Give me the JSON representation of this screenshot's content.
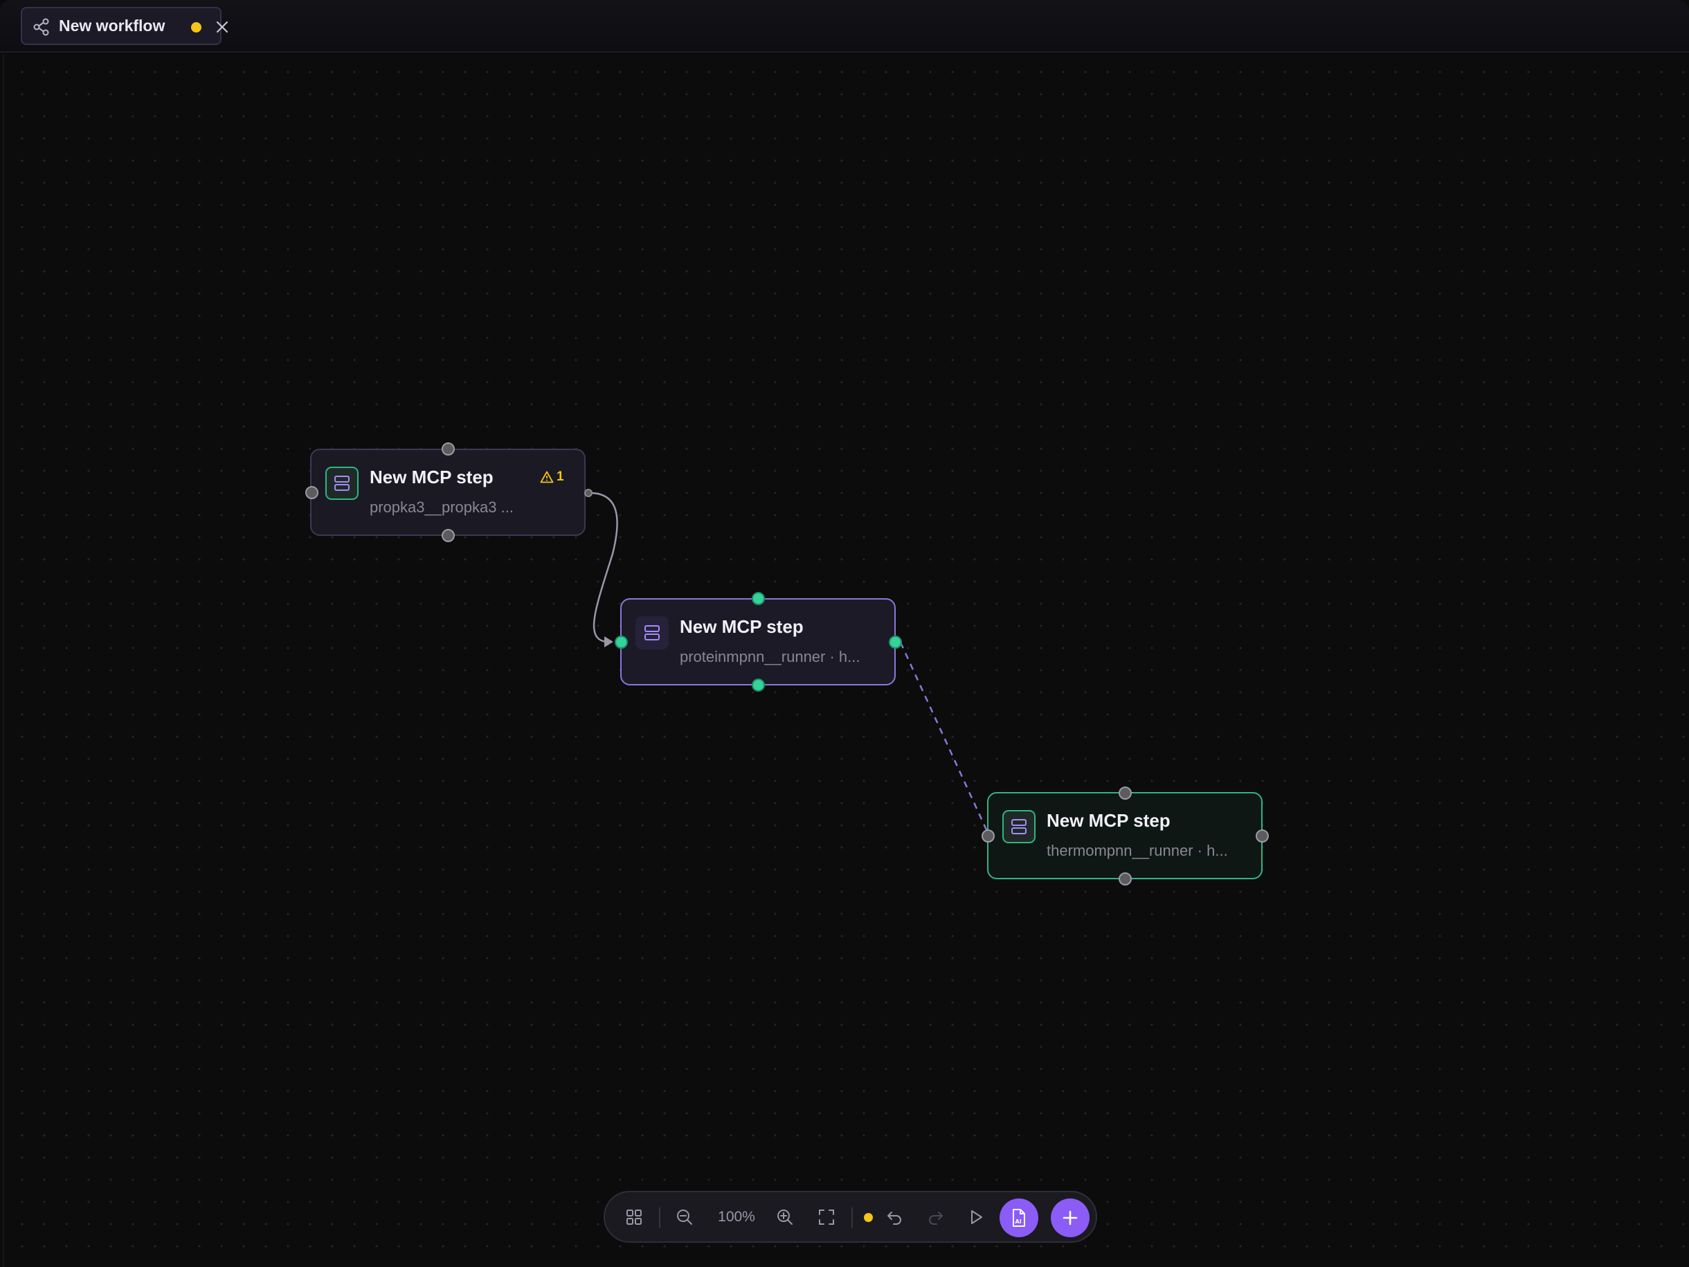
{
  "tab": {
    "title": "New workflow",
    "icon": "workflow-icon",
    "unsaved": true,
    "close_icon": "close-icon"
  },
  "nodes": [
    {
      "title": "New MCP step",
      "subtitle": "propka3__propka3 ...",
      "warning_count": "1",
      "icon": "server-icon"
    },
    {
      "title": "New MCP step",
      "subtitle": "proteinmpnn__runner · h...",
      "icon": "server-icon"
    },
    {
      "title": "New MCP step",
      "subtitle": "thermompnn__runner · h...",
      "icon": "server-icon"
    }
  ],
  "toolbar": {
    "zoom": "100%",
    "buttons": [
      "grid-layout-icon",
      "zoom-out-icon",
      "zoom-in-icon",
      "fit-view-icon",
      "undo-icon",
      "redo-icon",
      "run-icon",
      "ai-document-icon",
      "add-icon"
    ]
  },
  "colors": {
    "accent_purple": "#8b5cf6",
    "accent_green": "#34d399",
    "warning_yellow": "#f5c518",
    "background": "#0c0c0d"
  }
}
